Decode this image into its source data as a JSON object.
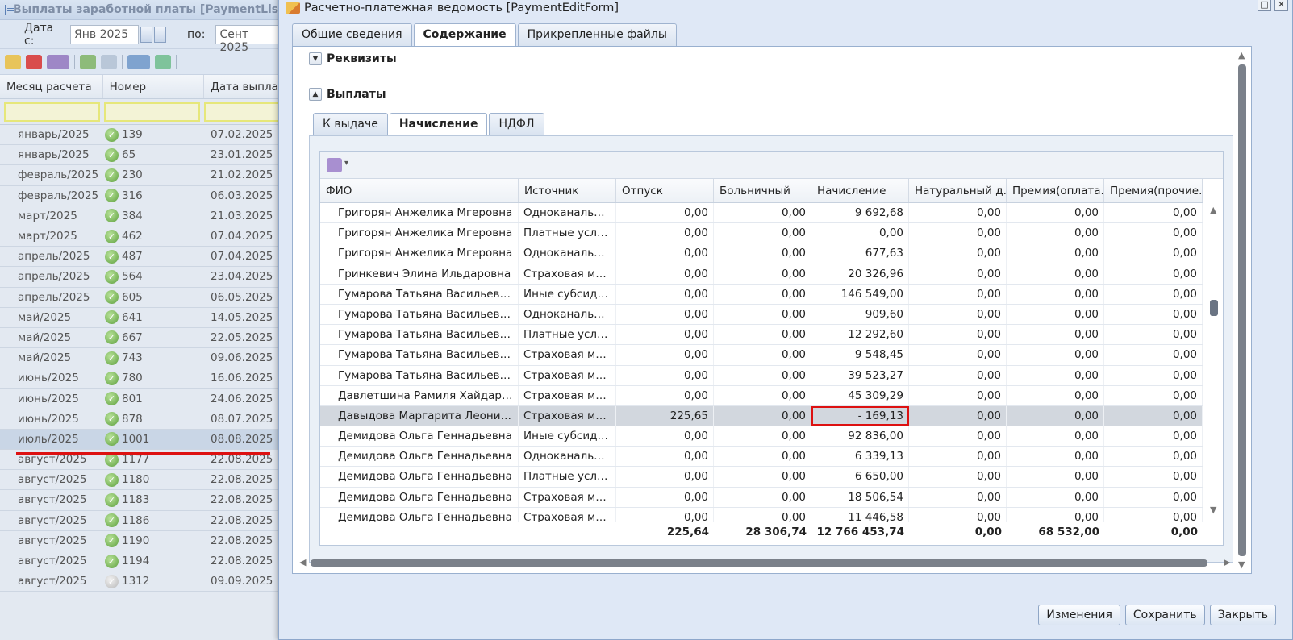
{
  "bg": {
    "title": "Выплаты заработной платы [PaymentListForm]",
    "date_from_label": "Дата с:",
    "date_from": "Янв 2025",
    "date_to_label": "по:",
    "date_to": "Сент 2025",
    "columns": [
      "Месяц расчета",
      "Номер",
      "Дата выплаты"
    ],
    "rows": [
      {
        "month": "январь/2025",
        "num": "139",
        "date": "07.02.2025",
        "status": "ok"
      },
      {
        "month": "январь/2025",
        "num": "65",
        "date": "23.01.2025",
        "status": "ok"
      },
      {
        "month": "февраль/2025",
        "num": "230",
        "date": "21.02.2025",
        "status": "ok"
      },
      {
        "month": "февраль/2025",
        "num": "316",
        "date": "06.03.2025",
        "status": "ok"
      },
      {
        "month": "март/2025",
        "num": "384",
        "date": "21.03.2025",
        "status": "ok"
      },
      {
        "month": "март/2025",
        "num": "462",
        "date": "07.04.2025",
        "status": "ok"
      },
      {
        "month": "апрель/2025",
        "num": "487",
        "date": "07.04.2025",
        "status": "ok"
      },
      {
        "month": "апрель/2025",
        "num": "564",
        "date": "23.04.2025",
        "status": "ok"
      },
      {
        "month": "апрель/2025",
        "num": "605",
        "date": "06.05.2025",
        "status": "ok"
      },
      {
        "month": "май/2025",
        "num": "641",
        "date": "14.05.2025",
        "status": "ok"
      },
      {
        "month": "май/2025",
        "num": "667",
        "date": "22.05.2025",
        "status": "ok"
      },
      {
        "month": "май/2025",
        "num": "743",
        "date": "09.06.2025",
        "status": "ok"
      },
      {
        "month": "июнь/2025",
        "num": "780",
        "date": "16.06.2025",
        "status": "ok"
      },
      {
        "month": "июнь/2025",
        "num": "801",
        "date": "24.06.2025",
        "status": "ok"
      },
      {
        "month": "июнь/2025",
        "num": "878",
        "date": "08.07.2025",
        "status": "ok"
      },
      {
        "month": "июль/2025",
        "num": "1001",
        "date": "08.08.2025",
        "status": "ok",
        "selected": true
      },
      {
        "month": "август/2025",
        "num": "1177",
        "date": "22.08.2025",
        "status": "ok"
      },
      {
        "month": "август/2025",
        "num": "1180",
        "date": "22.08.2025",
        "status": "ok"
      },
      {
        "month": "август/2025",
        "num": "1183",
        "date": "22.08.2025",
        "status": "ok"
      },
      {
        "month": "август/2025",
        "num": "1186",
        "date": "22.08.2025",
        "status": "ok"
      },
      {
        "month": "август/2025",
        "num": "1190",
        "date": "22.08.2025",
        "status": "ok"
      },
      {
        "month": "август/2025",
        "num": "1194",
        "date": "22.08.2025",
        "status": "ok"
      },
      {
        "month": "август/2025",
        "num": "1312",
        "date": "09.09.2025",
        "status": "grey"
      }
    ]
  },
  "win": {
    "title": "Расчетно-платежная ведомость [PaymentEditForm]",
    "tabs": [
      "Общие сведения",
      "Содержание",
      "Прикрепленные файлы"
    ],
    "active_tab": 1,
    "section1": "Реквизиты",
    "section2": "Выплаты",
    "inner_tabs": [
      "К выдаче",
      "Начисление",
      "НДФЛ"
    ],
    "inner_active": 1,
    "columns": [
      "ФИО",
      "Источник",
      "Отпуск",
      "Больничный",
      "Начисление",
      "Натуральный д...",
      "Премия(оплата...",
      "Премия(прочие..."
    ],
    "rows": [
      [
        "Григорян Анжелика Мгеровна",
        "Одноканальное...",
        "0,00",
        "0,00",
        "9 692,68",
        "0,00",
        "0,00",
        "0,00"
      ],
      [
        "Григорян Анжелика Мгеровна",
        "Платные услуг...",
        "0,00",
        "0,00",
        "0,00",
        "0,00",
        "0,00",
        "0,00"
      ],
      [
        "Григорян Анжелика Мгеровна",
        "Одноканальное...",
        "0,00",
        "0,00",
        "677,63",
        "0,00",
        "0,00",
        "0,00"
      ],
      [
        "Гринкевич Элина Ильдаровна",
        "Страховая мед...",
        "0,00",
        "0,00",
        "20 326,96",
        "0,00",
        "0,00",
        "0,00"
      ],
      [
        "Гумарова Татьяна Васильевна",
        "Иные субсидии...",
        "0,00",
        "0,00",
        "146 549,00",
        "0,00",
        "0,00",
        "0,00"
      ],
      [
        "Гумарова Татьяна Васильевна",
        "Одноканальное...",
        "0,00",
        "0,00",
        "909,60",
        "0,00",
        "0,00",
        "0,00"
      ],
      [
        "Гумарова Татьяна Васильевна",
        "Платные услуг...",
        "0,00",
        "0,00",
        "12 292,60",
        "0,00",
        "0,00",
        "0,00"
      ],
      [
        "Гумарова Татьяна Васильевна",
        "Страховая мед...",
        "0,00",
        "0,00",
        "9 548,45",
        "0,00",
        "0,00",
        "0,00"
      ],
      [
        "Гумарова Татьяна Васильевна",
        "Страховая мед...",
        "0,00",
        "0,00",
        "39 523,27",
        "0,00",
        "0,00",
        "0,00"
      ],
      [
        "Давлетшина Рамиля Хайдаровна",
        "Страховая мед...",
        "0,00",
        "0,00",
        "45 309,29",
        "0,00",
        "0,00",
        "0,00"
      ],
      [
        "Давыдова Маргарита Леонидовна",
        "Страховая мед...",
        "225,65",
        "0,00",
        "- 169,13",
        "0,00",
        "0,00",
        "0,00"
      ],
      [
        "Демидова Ольга Геннадьевна",
        "Иные субсидии...",
        "0,00",
        "0,00",
        "92 836,00",
        "0,00",
        "0,00",
        "0,00"
      ],
      [
        "Демидова Ольга Геннадьевна",
        "Одноканальное...",
        "0,00",
        "0,00",
        "6 339,13",
        "0,00",
        "0,00",
        "0,00"
      ],
      [
        "Демидова Ольга Геннадьевна",
        "Платные услуг...",
        "0,00",
        "0,00",
        "6 650,00",
        "0,00",
        "0,00",
        "0,00"
      ],
      [
        "Демидова Ольга Геннадьевна",
        "Страховая мед...",
        "0,00",
        "0,00",
        "18 506,54",
        "0,00",
        "0,00",
        "0,00"
      ],
      [
        "Демидова Ольга Геннадьевна",
        "Страховая мед...",
        "0,00",
        "0,00",
        "11 446,58",
        "0,00",
        "0,00",
        "0,00"
      ]
    ],
    "selected_row": 10,
    "totals": [
      "",
      "",
      "225,64",
      "28 306,74",
      "12 766 453,74",
      "0,00",
      "68 532,00",
      "0,00"
    ],
    "buttons": [
      "Изменения",
      "Сохранить",
      "Закрыть"
    ]
  }
}
